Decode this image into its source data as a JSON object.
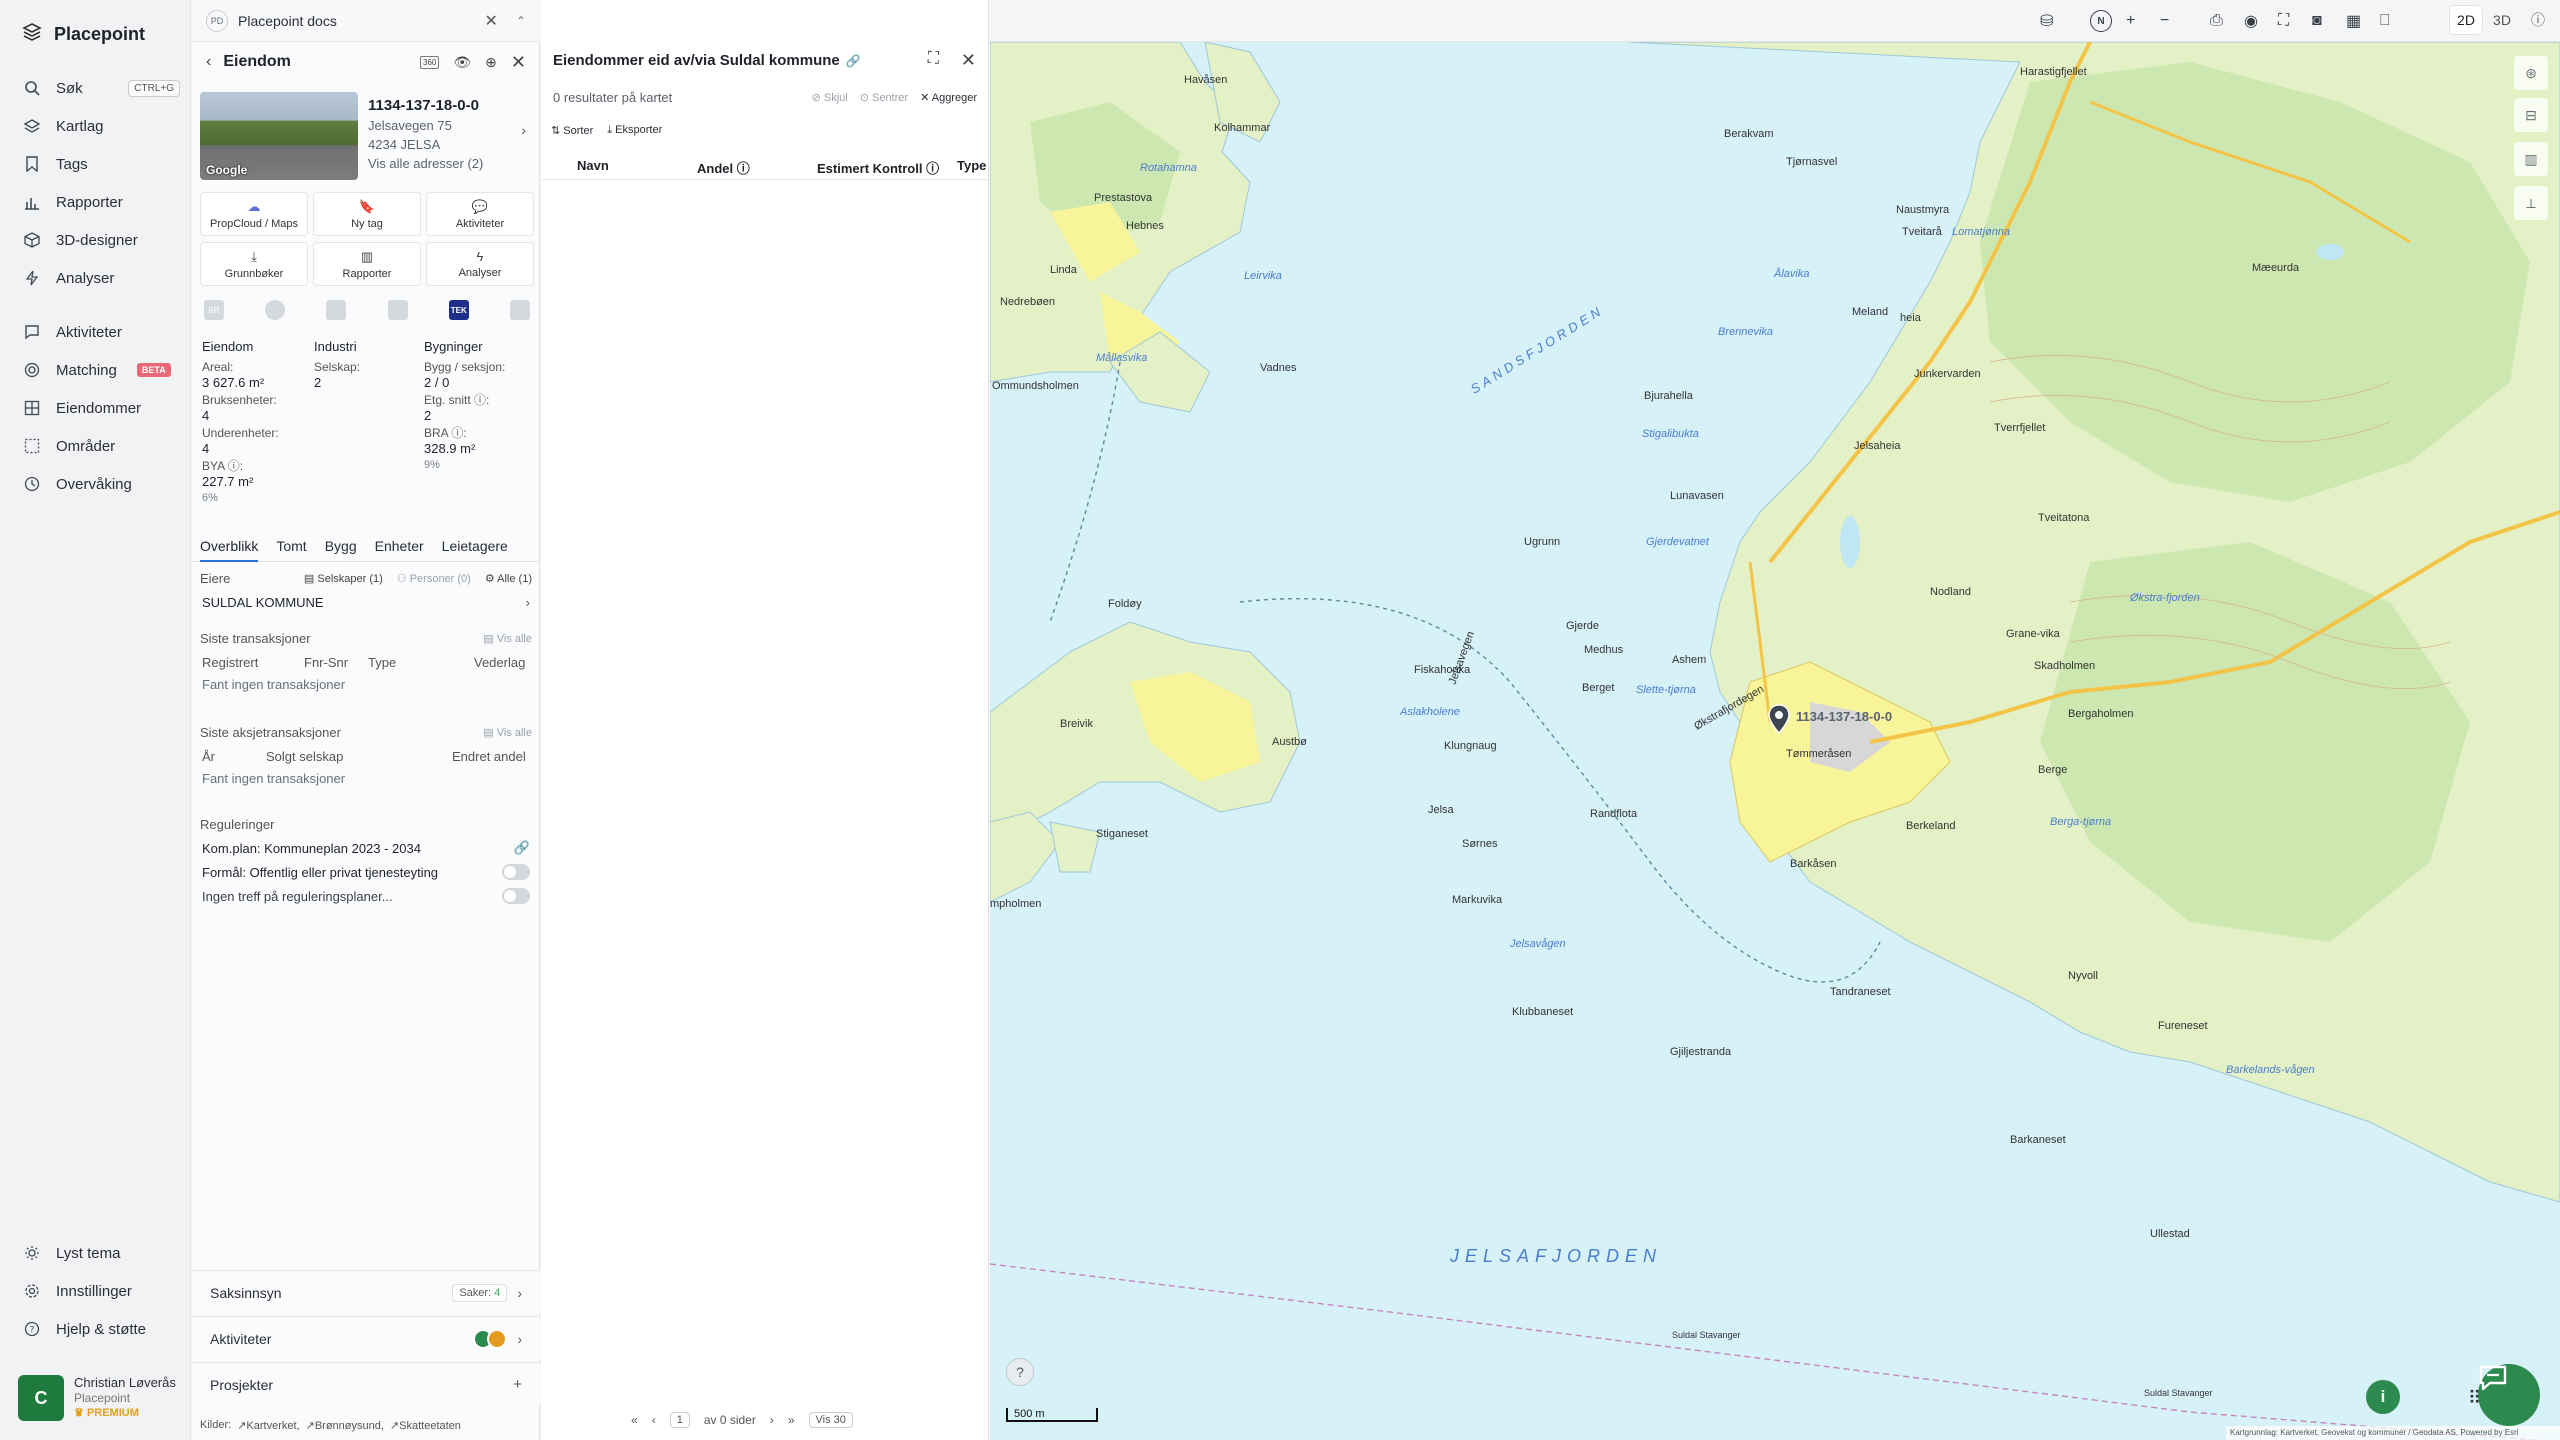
{
  "nav": {
    "brand": "Placepoint",
    "items": [
      {
        "label": "Søk",
        "shortcut": "CTRL+G"
      },
      {
        "label": "Kartlag"
      },
      {
        "label": "Tags"
      },
      {
        "label": "Rapporter"
      },
      {
        "label": "3D-designer"
      },
      {
        "label": "Analyser"
      },
      {
        "label": "Aktiviteter"
      },
      {
        "label": "Matching",
        "badge": "BETA"
      },
      {
        "label": "Eiendommer"
      },
      {
        "label": "Områder"
      },
      {
        "label": "Overvåking"
      }
    ],
    "bottom": [
      {
        "label": "Lyst tema"
      },
      {
        "label": "Innstillinger"
      },
      {
        "label": "Hjelp & støtte"
      }
    ],
    "user": {
      "initial": "C",
      "name": "Christian Løverås",
      "org": "Placepoint",
      "plan": "PREMIUM"
    }
  },
  "docs": {
    "badge": "PD",
    "title": "Placepoint docs"
  },
  "property": {
    "header": "Eiendom",
    "chip": "360",
    "id": "1134-137-18-0-0",
    "street": "Jelsavegen 75",
    "postal": "4234 JELSA",
    "all_addresses": "Vis alle adresser (2)",
    "photo_brand": "Google",
    "actions": [
      "PropCloud / Maps",
      "Ny tag",
      "Aktiviteter",
      "Grunnbøker",
      "Rapporter",
      "Analyser"
    ],
    "sources": [
      "BR",
      "",
      "",
      "",
      "TEK",
      ""
    ],
    "stats": {
      "eiendom": {
        "title": "Eiendom",
        "areal_label": "Areal:",
        "areal": "3 627.6 m²",
        "bruks_label": "Bruksenheter:",
        "bruks": "4",
        "under_label": "Underenheter:",
        "under": "4",
        "bya_label": "BYA ⓘ:",
        "bya": "227.7 m²",
        "bya_pct": "6%"
      },
      "industri": {
        "title": "Industri",
        "selskap_label": "Selskap:",
        "selskap": "2"
      },
      "bygninger": {
        "title": "Bygninger",
        "bygg_label": "Bygg / seksjon:",
        "bygg": "2 / 0",
        "etg_label": "Etg. snitt ⓘ:",
        "etg": "2",
        "bra_label": "BRA ⓘ:",
        "bra": "328.9 m²",
        "bra_pct": "9%"
      }
    },
    "tabs": [
      "Overblikk",
      "Tomt",
      "Bygg",
      "Enheter",
      "Leietagere"
    ],
    "owners": {
      "title": "Eiere",
      "selskaper": "Selskaper (1)",
      "personer": "Personer (0)",
      "alle": "Alle (1)",
      "name": "SULDAL KOMMUNE"
    },
    "transactions": {
      "title": "Siste transaksjoner",
      "see_all": "Vis alle",
      "cols": [
        "Registrert",
        "Fnr-Snr",
        "Type",
        "Vederlag"
      ],
      "empty": "Fant ingen transaksjoner"
    },
    "share_transactions": {
      "title": "Siste aksjetransaksjoner",
      "see_all": "Vis alle",
      "cols": [
        "År",
        "Solgt selskap",
        "Endret andel"
      ],
      "empty": "Fant ingen transaksjoner"
    },
    "regulations": {
      "title": "Reguleringer",
      "plan": "Kom.plan: Kommuneplan 2023 - 2034",
      "purpose": "Formål: Offentlig eller privat tjenesteyting",
      "none": "Ingen treff på reguleringsplaner..."
    },
    "bottom": {
      "saksinnsyn": "Saksinnsyn",
      "saker_label": "Saker:",
      "saker_count": "4",
      "aktiviteter": "Aktiviteter",
      "prosjekter": "Prosjekter"
    },
    "sources_footer": {
      "label": "Kilder:",
      "items": [
        "Kartverket",
        "Brønnøysund",
        "Skatteetaten"
      ]
    }
  },
  "results": {
    "title": "Eiendommer eid av/via Suldal kommune",
    "count": "0 resultater på kartet",
    "hide": "Skjul",
    "center": "Sentrer",
    "aggregate": "Aggreger",
    "sort": "Sorter",
    "export": "Eksporter",
    "columns": [
      "Navn",
      "Andel ⓘ",
      "Estimert Kontroll ⓘ",
      "Type"
    ],
    "pager": {
      "page": "1",
      "of": "av 0 sider",
      "per_page": "Vis 30"
    }
  },
  "map": {
    "labels": {
      "havasen": "Havåsen",
      "kolhammar": "Kolhammar",
      "rotahamna": "Rotahamna",
      "prestastova": "Prestastova",
      "hebnes": "Hebnes",
      "linda": "Linda",
      "leirvika": "Leirvika",
      "nedrebeen": "Nedrebøen",
      "mallasvika": "Mållasvika",
      "vadnes": "Vadnes",
      "ommundsholmen": "Ommundsholmen",
      "sandsfjorden": "SANDSFJORDEN",
      "foldoy": "Foldøy",
      "breivik": "Breivik",
      "austbo": "Austbø",
      "stiganeset": "Stiganeset",
      "jelsafjorden": "JELSAFJORDEN",
      "holmen": "mpholmen",
      "berakvam": "Berakvam",
      "harastigfjellet": "Harastigfjellet",
      "tjornasvel": "Tjørnasvel",
      "naustmyra": "Naustmyra",
      "alavika": "Ålavika",
      "lomatjonna": "Lomatjønna",
      "tveitara": "Tveitarå",
      "maeurda": "Mæeurda",
      "brennevika": "Brennevika",
      "meland": "Meland",
      "heia": "heia",
      "junkervarden": "Junkervarden",
      "tverrfjellet": "Tverrfjellet",
      "bjurahella": "Bjurahella",
      "stigalibukta": "Stigalibukta",
      "jelsaheia": "Jelsaheia",
      "lunavasen": "Lunavasen",
      "ugrunn": "Ugrunn",
      "gjerdevatnet": "Gjerdevatnet",
      "nodland": "Nodland",
      "tveitatona": "Tveitatona",
      "okstrafjordegen": "Økstrafjordegen",
      "okstrafjorden": "Økstra-fjorden",
      "gjerde": "Gjerde",
      "grane": "Grane-vika",
      "skadholmen": "Skadholmen",
      "fiskahonka": "Fiskahonka",
      "medhus": "Medhus",
      "ashem": "Ashem",
      "aslakholene": "Aslakholene",
      "berget": "Berget",
      "bergaholmen": "Bergaholmen",
      "klungnaug": "Klungnaug",
      "tommerasen": "Tømmeråsen",
      "slette": "Slette-tjørna",
      "berge": "Berge",
      "jelsa": "Jelsa",
      "sornes": "Sørnes",
      "randflota": "Randflota",
      "berkeland": "Berkeland",
      "bergatjorna": "Berga-tjørna",
      "markuvika": "Markuvika",
      "barkasen": "Barkåsen",
      "jelsavagen": "Jelsavågen",
      "klubbaneset": "Klubbaneset",
      "tandraneset": "Tandraneset",
      "nyvoll": "Nyvoll",
      "fureneset": "Fureneset",
      "gjiljestranda": "Gjiljestranda",
      "barkelandsvagen": "Barkelands-vågen",
      "barkaneset": "Barkaneset",
      "ullestad": "Ullestad",
      "suldal1": "Suldal Stavanger",
      "suldal2": "Suldal Stavanger",
      "jelsavegen": "Jelsavegen"
    },
    "marker_label": "1134-137-18-0-0",
    "scale": "500 m",
    "credits": "Kartgrunnlag: Kartverket, Geovekst og kommuner / Geodata AS, Powered by Esri",
    "colors": {
      "water": "#d6f1f8",
      "land": "#e4f1c6",
      "forest": "#cde7b0",
      "urban": "#f7f49a",
      "road": "#f3c447",
      "accent": "#2d8a4e"
    }
  },
  "toolbar": {
    "view_2d": "2D",
    "view_3d": "3D",
    "north": "N"
  }
}
